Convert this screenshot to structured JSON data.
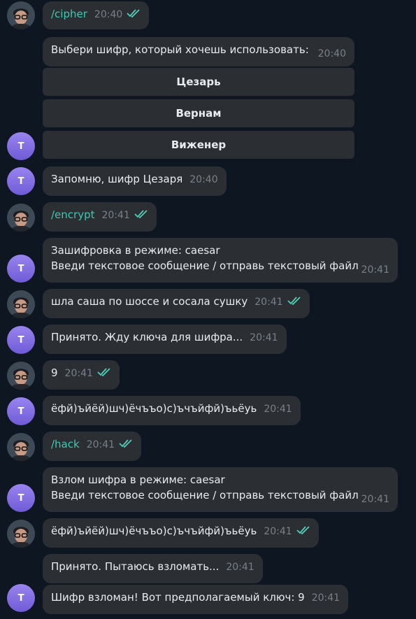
{
  "messages": [
    {
      "id": "m1",
      "sender": "user",
      "text": "/cipher",
      "is_command": true,
      "time": "20:40",
      "read": true
    },
    {
      "id": "m2",
      "sender": "bot",
      "text": "Выбери шифр, который хочешь использовать:",
      "time": "20:40",
      "keyboard": [
        "Цезарь",
        "Вернам",
        "Виженер"
      ]
    },
    {
      "id": "m3",
      "sender": "bot",
      "text": "Запомню, шифр Цезаря",
      "time": "20:40"
    },
    {
      "id": "m4",
      "sender": "user",
      "text": "/encrypt",
      "is_command": true,
      "time": "20:41",
      "read": true
    },
    {
      "id": "m5",
      "sender": "bot",
      "lines": [
        "Зашифровка в режиме: caesar",
        "Введи текстовое сообщение / отправь текстовый файл"
      ],
      "time": "20:41"
    },
    {
      "id": "m6",
      "sender": "user",
      "text": "шла саша по шоссе и сосала сушку",
      "time": "20:41",
      "read": true
    },
    {
      "id": "m7",
      "sender": "bot",
      "text": "Принято. Жду ключа для шифра...",
      "time": "20:41"
    },
    {
      "id": "m8",
      "sender": "user",
      "text": "9",
      "time": "20:41",
      "read": true
    },
    {
      "id": "m9",
      "sender": "bot",
      "text": "ёфй)ъйёй)шч)ёчъъо)с)ъчъйфй)ъьёуь",
      "time": "20:41"
    },
    {
      "id": "m10",
      "sender": "user",
      "text": "/hack",
      "is_command": true,
      "time": "20:41",
      "read": true
    },
    {
      "id": "m11",
      "sender": "bot",
      "lines": [
        "Взлом шифра в режиме: caesar",
        "Введи текстовое сообщение / отправь текстовый файл"
      ],
      "time": "20:41"
    },
    {
      "id": "m12",
      "sender": "user",
      "text": "ёфй)ъйёй)шч)ёчъъо)с)ъчъйфй)ъьёуь",
      "time": "20:41",
      "read": true
    },
    {
      "id": "m13",
      "sender": "bot",
      "text": "Принято. Пытаюсь взломать...",
      "time": "20:41"
    },
    {
      "id": "m14",
      "sender": "bot",
      "text": "Шифр взломан! Вот предполагаемый ключ: 9",
      "time": "20:41"
    }
  ],
  "bot_avatar_letter": "T",
  "colors": {
    "background": "#0e1621",
    "bubble": "#2b2e33",
    "command": "#3ec9b3",
    "check": "#4fcfb7",
    "time": "#7a8087"
  },
  "icons": {
    "read_receipt": "double-check-icon",
    "user_avatar": "user-avatar-photo"
  }
}
